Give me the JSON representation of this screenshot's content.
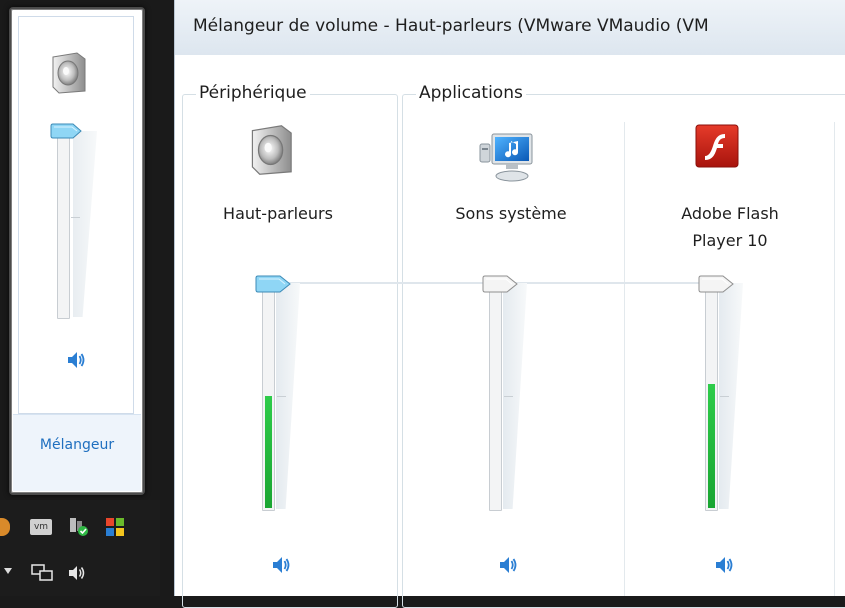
{
  "flyout": {
    "mixer_link": "Mélangeur",
    "level": 0.95
  },
  "window": {
    "title": "Mélangeur de volume - Haut-parleurs (VMware VMaudio (VM"
  },
  "groups": {
    "device_label": "Périphérique",
    "apps_label": "Applications"
  },
  "channels": [
    {
      "id": "speakers",
      "label": "Haut-parleurs",
      "icon": "speaker-icon",
      "volume": 1.0,
      "meter": 0.49
    },
    {
      "id": "system-sounds",
      "label": "Sons système",
      "icon": "system-sounds-icon",
      "volume": 1.0,
      "meter": 0.0
    },
    {
      "id": "flash",
      "label_line1": "Adobe Flash",
      "label_line2": "Player 10",
      "icon": "adobe-flash-icon",
      "volume": 1.0,
      "meter": 0.56
    }
  ],
  "colors": {
    "meter": "#22b83e",
    "active_thumb": "#8fd6f5",
    "link": "#1f6fbf"
  }
}
